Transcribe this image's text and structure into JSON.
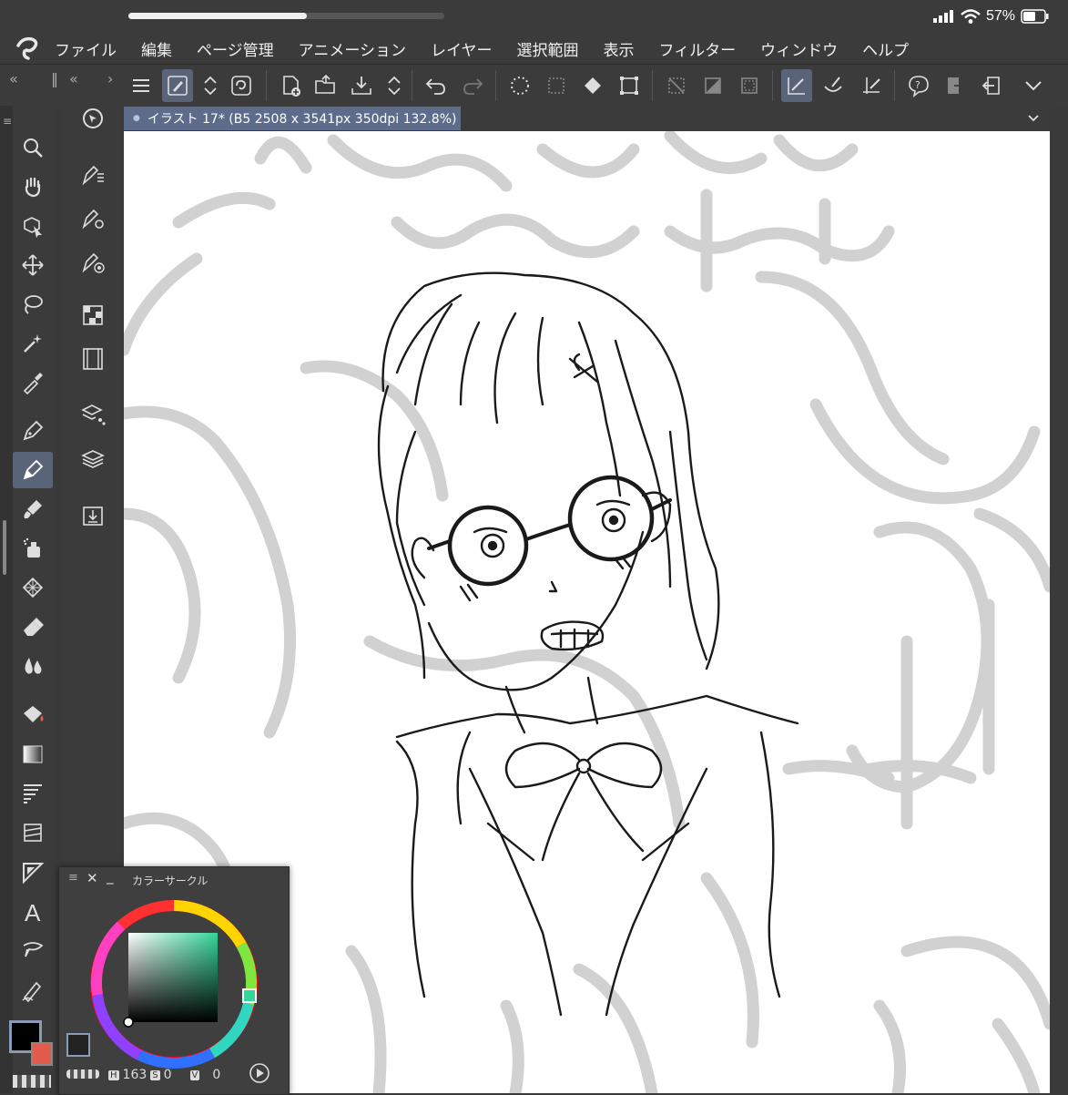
{
  "status": {
    "battery": "57%"
  },
  "menu": [
    "ファイル",
    "編集",
    "ページ管理",
    "アニメーション",
    "レイヤー",
    "選択範囲",
    "表示",
    "フィルター",
    "ウィンドウ",
    "ヘルプ"
  ],
  "document": {
    "tab_label": "イラスト 17* (B5 2508 x 3541px 350dpi 132.8%)"
  },
  "palette": {
    "title": "カラーサークル",
    "h_key": "H",
    "h": "163",
    "s_key": "S",
    "s": "0",
    "v_key": "V",
    "v": "0"
  },
  "colors": {
    "main": "#000000",
    "sub": "#e25c4e",
    "accent": "#5a6478",
    "tab": "#5c6c8a"
  }
}
